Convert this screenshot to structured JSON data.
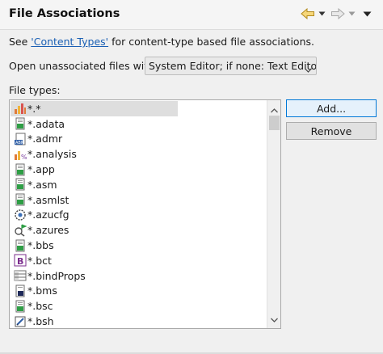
{
  "header": {
    "title": "File Associations",
    "nav_icons": [
      "back-arrow-icon",
      "dropdown-icon",
      "forward-arrow-icon",
      "dropdown-icon",
      "view-menu-icon"
    ]
  },
  "content_types": {
    "prefix": "See ",
    "link_text": "'Content Types'",
    "suffix": " for content-type based file associations."
  },
  "open_with": {
    "label": "Open unassociated files with:",
    "selected": "System Editor; if none: Text Editor"
  },
  "file_types": {
    "label": "File types:",
    "items": [
      {
        "label": "*.*",
        "icon": "chart-editor-icon",
        "selected": true
      },
      {
        "label": "*.adata",
        "icon": "document-green-icon"
      },
      {
        "label": "*.admr",
        "icon": "abm-document-icon"
      },
      {
        "label": "*.analysis",
        "icon": "analysis-chart-icon"
      },
      {
        "label": "*.app",
        "icon": "document-green-icon"
      },
      {
        "label": "*.asm",
        "icon": "document-green-icon"
      },
      {
        "label": "*.asmlst",
        "icon": "document-green-icon"
      },
      {
        "label": "*.azucfg",
        "icon": "gear-globe-icon"
      },
      {
        "label": "*.azures",
        "icon": "search-flag-icon"
      },
      {
        "label": "*.bbs",
        "icon": "document-green-icon"
      },
      {
        "label": "*.bct",
        "icon": "b-purple-icon"
      },
      {
        "label": "*.bindProps",
        "icon": "properties-table-icon"
      },
      {
        "label": "*.bms",
        "icon": "document-dark-icon"
      },
      {
        "label": "*.bsc",
        "icon": "document-green-icon"
      },
      {
        "label": "*.bsh",
        "icon": "edit-script-icon"
      }
    ]
  },
  "buttons": {
    "add": "Add...",
    "remove": "Remove"
  },
  "colors": {
    "link": "#1a5fb4",
    "default_button_border": "#0078d7",
    "selection": "#dedede"
  }
}
